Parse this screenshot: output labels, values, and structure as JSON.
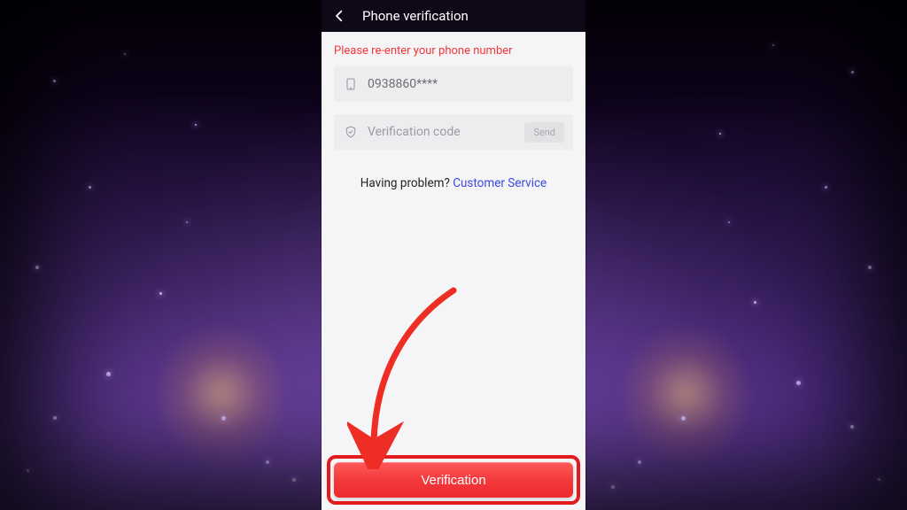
{
  "header": {
    "title": "Phone verification"
  },
  "icons": {
    "back": "chevron-left-icon",
    "phone_field": "phone-icon",
    "code_field": "shield-check-icon"
  },
  "form": {
    "error_message": "Please re-enter your phone number",
    "phone_value": "0938860****",
    "code_placeholder": "Verification code",
    "send_label": "Send"
  },
  "help": {
    "prompt": "Having problem? ",
    "link_label": "Customer Service"
  },
  "primary_action": {
    "label": "Verification"
  },
  "colors": {
    "error": "#f2373b",
    "link": "#3b49df",
    "primary_button": "#f03a3d",
    "annotation": "#ee2e24"
  },
  "annotation": {
    "arrow_target": "verification-button",
    "highlight_target": "verification-button"
  }
}
